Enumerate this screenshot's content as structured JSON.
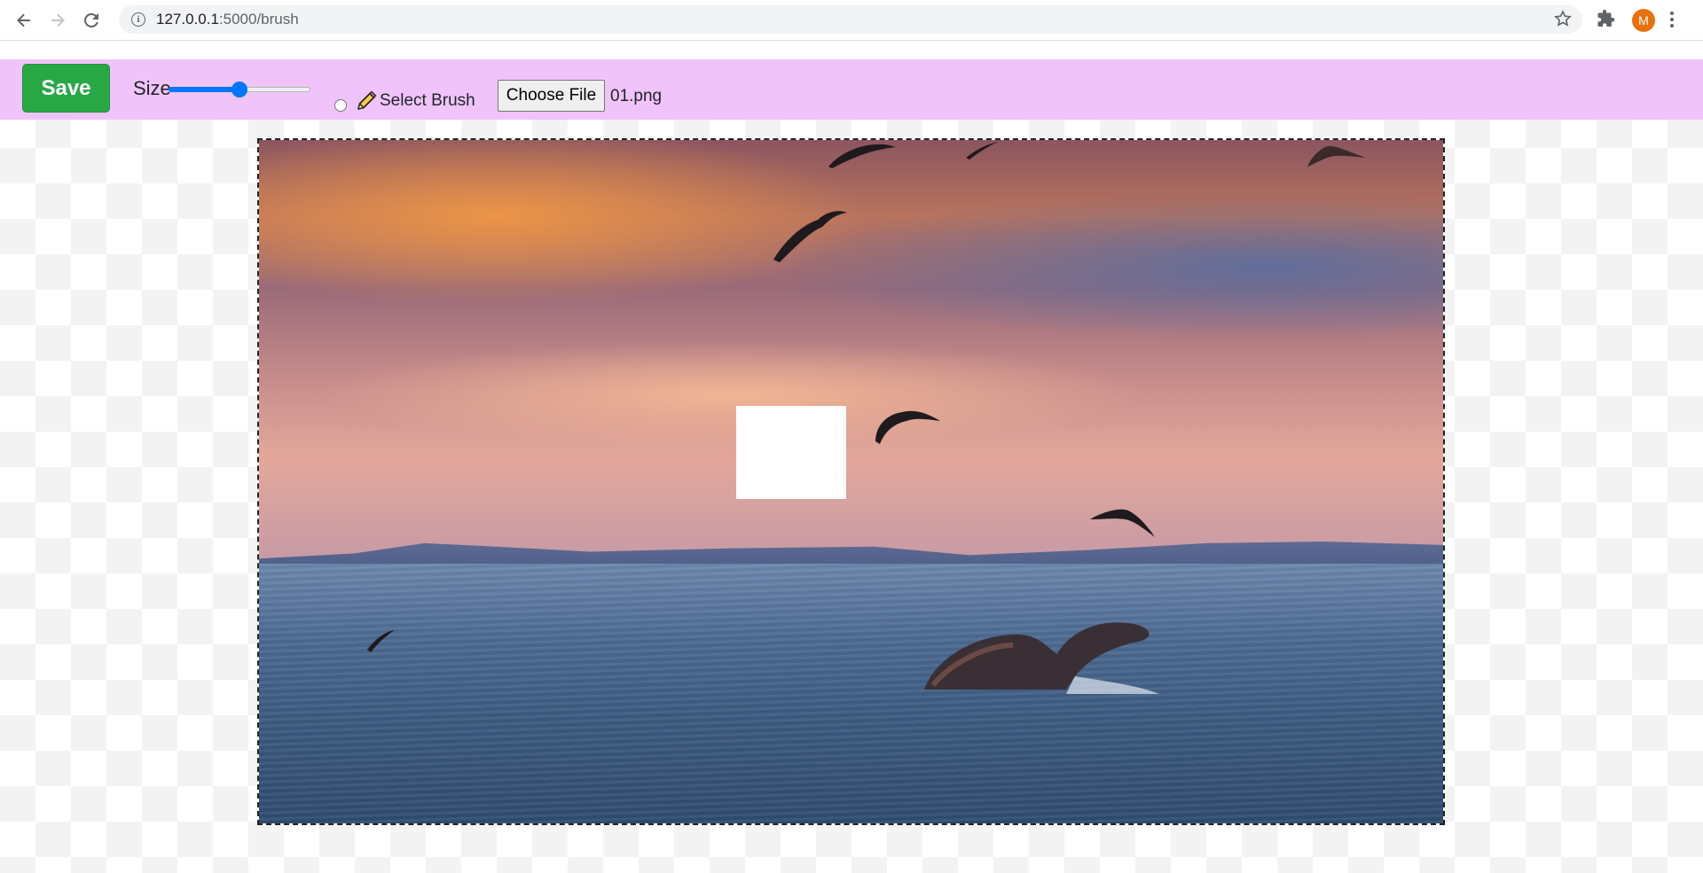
{
  "browser": {
    "url_host": "127.0.0.1",
    "url_path": ":5000/brush",
    "avatar_letter": "M"
  },
  "toolbar": {
    "save_label": "Save",
    "size_label": "Size",
    "size_value_fraction": 0.5,
    "brush_label": "Select Brush",
    "choose_file_label": "Choose File",
    "file_name": "01.png"
  },
  "colors": {
    "toolbar_bg": "#f0c4fb",
    "save_bg": "#28a745",
    "slider_accent": "#0075ff",
    "avatar_bg": "#e8710a"
  },
  "canvas": {
    "image_description_icon": "seascape-photo"
  }
}
